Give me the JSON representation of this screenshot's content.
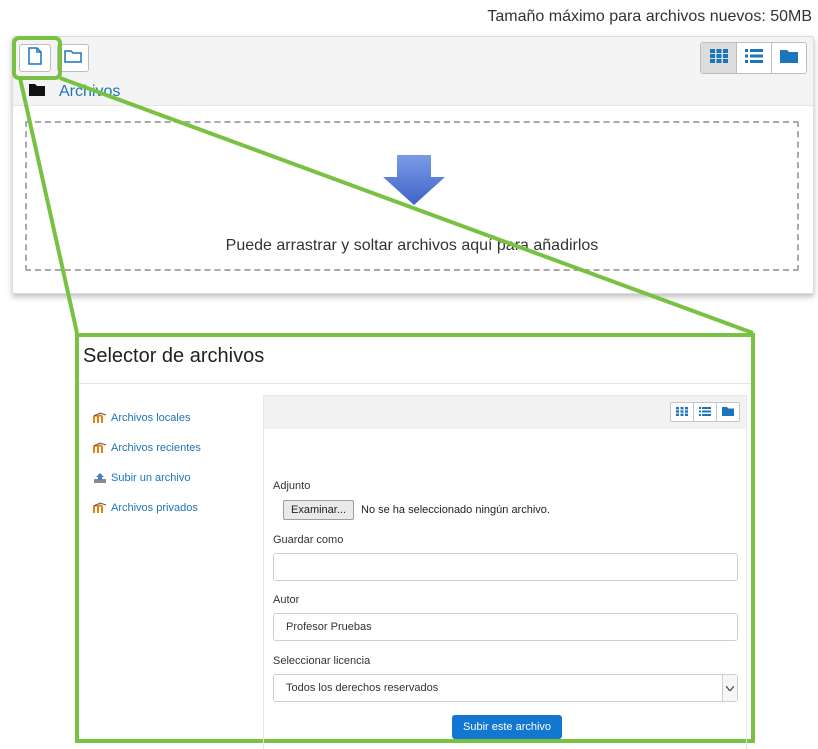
{
  "filemanager": {
    "max_size_text": "Tamaño máximo para archivos nuevos: 50MB",
    "breadcrumb_label": "Archivos",
    "dropzone_text": "Puede arrastrar y soltar archivos aquí para añadirlos",
    "toolbar_icons": [
      "add-file-icon",
      "create-folder-icon"
    ],
    "view_icons": [
      "grid-view-icon",
      "list-view-icon",
      "tree-view-icon"
    ]
  },
  "file_picker": {
    "title": "Selector de archivos",
    "repositories": [
      {
        "label": "Archivos locales",
        "icon": "moodle-icon"
      },
      {
        "label": "Archivos recientes",
        "icon": "moodle-icon"
      },
      {
        "label": "Subir un archivo",
        "icon": "upload-icon"
      },
      {
        "label": "Archivos privados",
        "icon": "moodle-icon"
      }
    ],
    "form": {
      "attachment_label": "Adjunto",
      "browse_button": "Examinar...",
      "no_file_text": "No se ha seleccionado ningún archivo.",
      "save_as_label": "Guardar como",
      "save_as_value": "",
      "author_label": "Autor",
      "author_value": "Profesor Pruebas",
      "license_label": "Seleccionar licencia",
      "license_value": "Todos los derechos reservados",
      "submit_button": "Subir este archivo"
    }
  },
  "colors": {
    "highlight": "#79c143",
    "link": "#1b75bb",
    "primary_button": "#1177d1"
  }
}
